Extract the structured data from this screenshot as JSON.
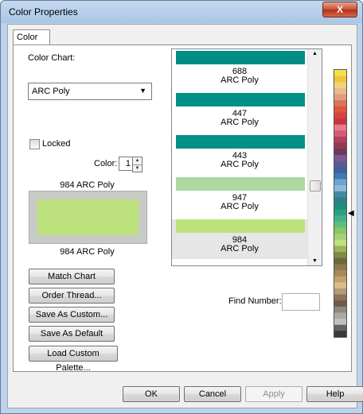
{
  "window": {
    "title": "Color Properties",
    "close_label": "X"
  },
  "tab": {
    "label": "Color"
  },
  "color_chart": {
    "label": "Color Chart:",
    "selected": "ARC Poly"
  },
  "locked": {
    "label": "Locked",
    "checked": false
  },
  "color_spin": {
    "label": "Color:",
    "value": "1"
  },
  "swatch": {
    "top_label": "984 ARC Poly",
    "bottom_label": "984 ARC Poly",
    "color": "#bde27d",
    "frame_color": "#c8cac6"
  },
  "buttons": {
    "match_chart": "Match Chart",
    "order_thread": "Order Thread...",
    "save_as_custom": "Save As Custom...",
    "save_as_default": "Save As Default",
    "load_custom_palette": "Load Custom Palette..."
  },
  "color_list": [
    {
      "number": "688",
      "chart": "ARC Poly",
      "color": "#008c87"
    },
    {
      "number": "447",
      "chart": "ARC Poly",
      "color": "#009085"
    },
    {
      "number": "443",
      "chart": "ARC Poly",
      "color": "#009088"
    },
    {
      "number": "947",
      "chart": "ARC Poly",
      "color": "#add8a2"
    },
    {
      "number": "984",
      "chart": "ARC Poly",
      "color": "#bde27d",
      "selected": true
    }
  ],
  "find_number": {
    "label": "Find Number:",
    "value": ""
  },
  "footer": {
    "ok": "OK",
    "cancel": "Cancel",
    "apply": "Apply",
    "help": "Help"
  },
  "palette_colors": [
    "#f5e14a",
    "#f0c43c",
    "#f2d27a",
    "#e9b98f",
    "#e39c7c",
    "#d9735d",
    "#e0553a",
    "#d4453d",
    "#c9353e",
    "#e87a8a",
    "#d6587a",
    "#b5405f",
    "#923a55",
    "#6b3a5b",
    "#7c5a8f",
    "#5b5a94",
    "#475c9c",
    "#3a7ab8",
    "#6fa4d0",
    "#8dbcd8",
    "#3f8ca0",
    "#2f7e8a",
    "#1f8d7b",
    "#2b9f86",
    "#43b08c",
    "#5fbf7a",
    "#8bc56a",
    "#a5d076",
    "#bde27d",
    "#9db45c",
    "#7f8a46",
    "#6a6a3a",
    "#8b7a4a",
    "#a58a58",
    "#c3a26c",
    "#d9bd8a",
    "#b39a78",
    "#8e7358",
    "#6e5a4a",
    "#8a8a80",
    "#a9a9a2",
    "#c2c2bc",
    "#5e6460",
    "#3a3a3a"
  ]
}
